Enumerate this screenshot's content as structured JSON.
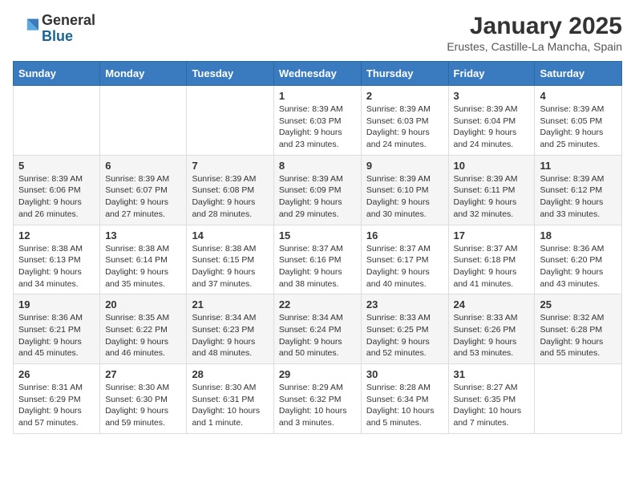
{
  "header": {
    "logo_general": "General",
    "logo_blue": "Blue",
    "title": "January 2025",
    "subtitle": "Erustes, Castille-La Mancha, Spain"
  },
  "weekdays": [
    "Sunday",
    "Monday",
    "Tuesday",
    "Wednesday",
    "Thursday",
    "Friday",
    "Saturday"
  ],
  "weeks": [
    [
      {
        "day": "",
        "info": ""
      },
      {
        "day": "",
        "info": ""
      },
      {
        "day": "",
        "info": ""
      },
      {
        "day": "1",
        "info": "Sunrise: 8:39 AM\nSunset: 6:03 PM\nDaylight: 9 hours\nand 23 minutes."
      },
      {
        "day": "2",
        "info": "Sunrise: 8:39 AM\nSunset: 6:03 PM\nDaylight: 9 hours\nand 24 minutes."
      },
      {
        "day": "3",
        "info": "Sunrise: 8:39 AM\nSunset: 6:04 PM\nDaylight: 9 hours\nand 24 minutes."
      },
      {
        "day": "4",
        "info": "Sunrise: 8:39 AM\nSunset: 6:05 PM\nDaylight: 9 hours\nand 25 minutes."
      }
    ],
    [
      {
        "day": "5",
        "info": "Sunrise: 8:39 AM\nSunset: 6:06 PM\nDaylight: 9 hours\nand 26 minutes."
      },
      {
        "day": "6",
        "info": "Sunrise: 8:39 AM\nSunset: 6:07 PM\nDaylight: 9 hours\nand 27 minutes."
      },
      {
        "day": "7",
        "info": "Sunrise: 8:39 AM\nSunset: 6:08 PM\nDaylight: 9 hours\nand 28 minutes."
      },
      {
        "day": "8",
        "info": "Sunrise: 8:39 AM\nSunset: 6:09 PM\nDaylight: 9 hours\nand 29 minutes."
      },
      {
        "day": "9",
        "info": "Sunrise: 8:39 AM\nSunset: 6:10 PM\nDaylight: 9 hours\nand 30 minutes."
      },
      {
        "day": "10",
        "info": "Sunrise: 8:39 AM\nSunset: 6:11 PM\nDaylight: 9 hours\nand 32 minutes."
      },
      {
        "day": "11",
        "info": "Sunrise: 8:39 AM\nSunset: 6:12 PM\nDaylight: 9 hours\nand 33 minutes."
      }
    ],
    [
      {
        "day": "12",
        "info": "Sunrise: 8:38 AM\nSunset: 6:13 PM\nDaylight: 9 hours\nand 34 minutes."
      },
      {
        "day": "13",
        "info": "Sunrise: 8:38 AM\nSunset: 6:14 PM\nDaylight: 9 hours\nand 35 minutes."
      },
      {
        "day": "14",
        "info": "Sunrise: 8:38 AM\nSunset: 6:15 PM\nDaylight: 9 hours\nand 37 minutes."
      },
      {
        "day": "15",
        "info": "Sunrise: 8:37 AM\nSunset: 6:16 PM\nDaylight: 9 hours\nand 38 minutes."
      },
      {
        "day": "16",
        "info": "Sunrise: 8:37 AM\nSunset: 6:17 PM\nDaylight: 9 hours\nand 40 minutes."
      },
      {
        "day": "17",
        "info": "Sunrise: 8:37 AM\nSunset: 6:18 PM\nDaylight: 9 hours\nand 41 minutes."
      },
      {
        "day": "18",
        "info": "Sunrise: 8:36 AM\nSunset: 6:20 PM\nDaylight: 9 hours\nand 43 minutes."
      }
    ],
    [
      {
        "day": "19",
        "info": "Sunrise: 8:36 AM\nSunset: 6:21 PM\nDaylight: 9 hours\nand 45 minutes."
      },
      {
        "day": "20",
        "info": "Sunrise: 8:35 AM\nSunset: 6:22 PM\nDaylight: 9 hours\nand 46 minutes."
      },
      {
        "day": "21",
        "info": "Sunrise: 8:34 AM\nSunset: 6:23 PM\nDaylight: 9 hours\nand 48 minutes."
      },
      {
        "day": "22",
        "info": "Sunrise: 8:34 AM\nSunset: 6:24 PM\nDaylight: 9 hours\nand 50 minutes."
      },
      {
        "day": "23",
        "info": "Sunrise: 8:33 AM\nSunset: 6:25 PM\nDaylight: 9 hours\nand 52 minutes."
      },
      {
        "day": "24",
        "info": "Sunrise: 8:33 AM\nSunset: 6:26 PM\nDaylight: 9 hours\nand 53 minutes."
      },
      {
        "day": "25",
        "info": "Sunrise: 8:32 AM\nSunset: 6:28 PM\nDaylight: 9 hours\nand 55 minutes."
      }
    ],
    [
      {
        "day": "26",
        "info": "Sunrise: 8:31 AM\nSunset: 6:29 PM\nDaylight: 9 hours\nand 57 minutes."
      },
      {
        "day": "27",
        "info": "Sunrise: 8:30 AM\nSunset: 6:30 PM\nDaylight: 9 hours\nand 59 minutes."
      },
      {
        "day": "28",
        "info": "Sunrise: 8:30 AM\nSunset: 6:31 PM\nDaylight: 10 hours\nand 1 minute."
      },
      {
        "day": "29",
        "info": "Sunrise: 8:29 AM\nSunset: 6:32 PM\nDaylight: 10 hours\nand 3 minutes."
      },
      {
        "day": "30",
        "info": "Sunrise: 8:28 AM\nSunset: 6:34 PM\nDaylight: 10 hours\nand 5 minutes."
      },
      {
        "day": "31",
        "info": "Sunrise: 8:27 AM\nSunset: 6:35 PM\nDaylight: 10 hours\nand 7 minutes."
      },
      {
        "day": "",
        "info": ""
      }
    ]
  ]
}
